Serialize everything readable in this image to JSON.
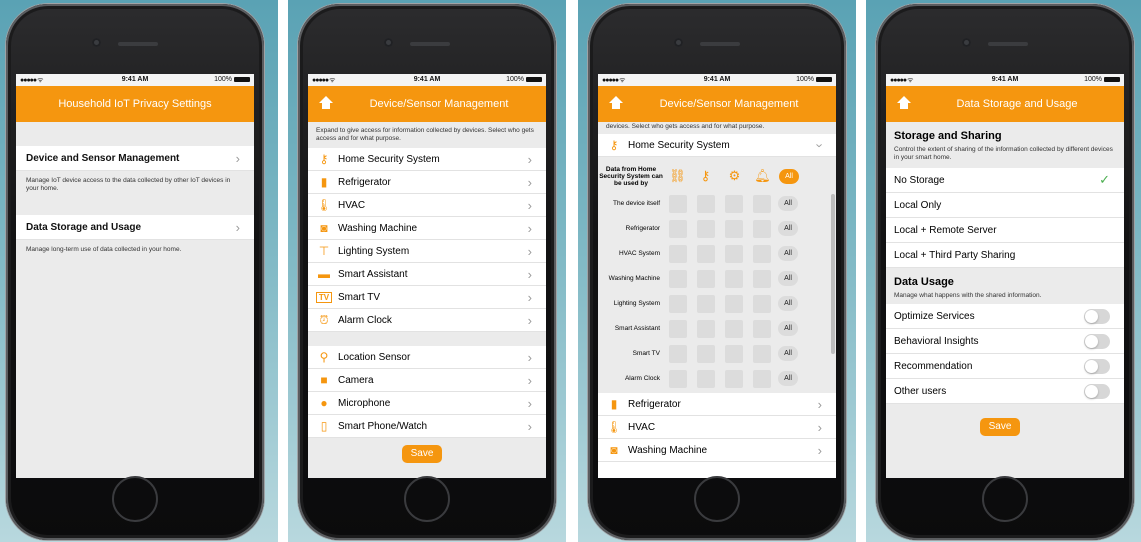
{
  "accent": "#f5960f",
  "status": {
    "signal": "●●●●● ᯤ",
    "time": "9:41 AM",
    "battery": "100%"
  },
  "screen1": {
    "title": "Household IoT Privacy Settings",
    "items": [
      {
        "label": "Device and Sensor Management",
        "description": "Manage IoT device access to the data collected by other IoT devices in your home."
      },
      {
        "label": "Data Storage and Usage",
        "description": "Manage long-term use of data collected in your home."
      }
    ]
  },
  "screen2": {
    "title": "Device/Sensor Management",
    "intro": "Expand to give access for information collected by devices. Select who gets access and for what purpose.",
    "devices": [
      {
        "label": "Home Security System",
        "icon": "key-icon"
      },
      {
        "label": "Refrigerator",
        "icon": "fridge-icon"
      },
      {
        "label": "HVAC",
        "icon": "thermometer-icon"
      },
      {
        "label": "Washing Machine",
        "icon": "washer-icon"
      },
      {
        "label": "Lighting System",
        "icon": "lamp-icon"
      },
      {
        "label": "Smart Assistant",
        "icon": "speaker-icon"
      },
      {
        "label": "Smart TV",
        "icon": "tv-icon"
      },
      {
        "label": "Alarm Clock",
        "icon": "alarm-icon"
      }
    ],
    "sensors": [
      {
        "label": "Location Sensor",
        "icon": "location-icon"
      },
      {
        "label": "Camera",
        "icon": "camera-icon"
      },
      {
        "label": "Microphone",
        "icon": "microphone-icon"
      },
      {
        "label": "Smart Phone/Watch",
        "icon": "phone-icon"
      }
    ],
    "save": "Save"
  },
  "screen3": {
    "title": "Device/Sensor Management",
    "intro_clipped": "devices. Select who gets access and for what purpose.",
    "expanded": "Home Security System",
    "matrix_header": "Data from Home Security System can be used by",
    "all_label": "All",
    "rows": [
      "The device itself",
      "Refrigerator",
      "HVAC System",
      "Washing Machine",
      "Lighting System",
      "Smart Assistant",
      "Smart TV",
      "Alarm Clock"
    ],
    "after": [
      {
        "label": "Refrigerator",
        "icon": "fridge-icon"
      },
      {
        "label": "HVAC",
        "icon": "thermometer-icon"
      },
      {
        "label": "Washing Machine",
        "icon": "washer-icon"
      }
    ]
  },
  "screen4": {
    "title": "Data Storage and Usage",
    "storage_heading": "Storage and Sharing",
    "storage_desc": "Control the extent of sharing of the information collected by different devices in your smart home.",
    "storage_options": [
      "No Storage",
      "Local Only",
      "Local + Remote Server",
      "Local + Third Party Sharing"
    ],
    "selected": "No Storage",
    "usage_heading": "Data Usage",
    "usage_desc": "Manage what happens with the shared information.",
    "usage_options": [
      "Optimize Services",
      "Behavioral Insights",
      "Recommendation",
      "Other users"
    ],
    "save": "Save"
  }
}
